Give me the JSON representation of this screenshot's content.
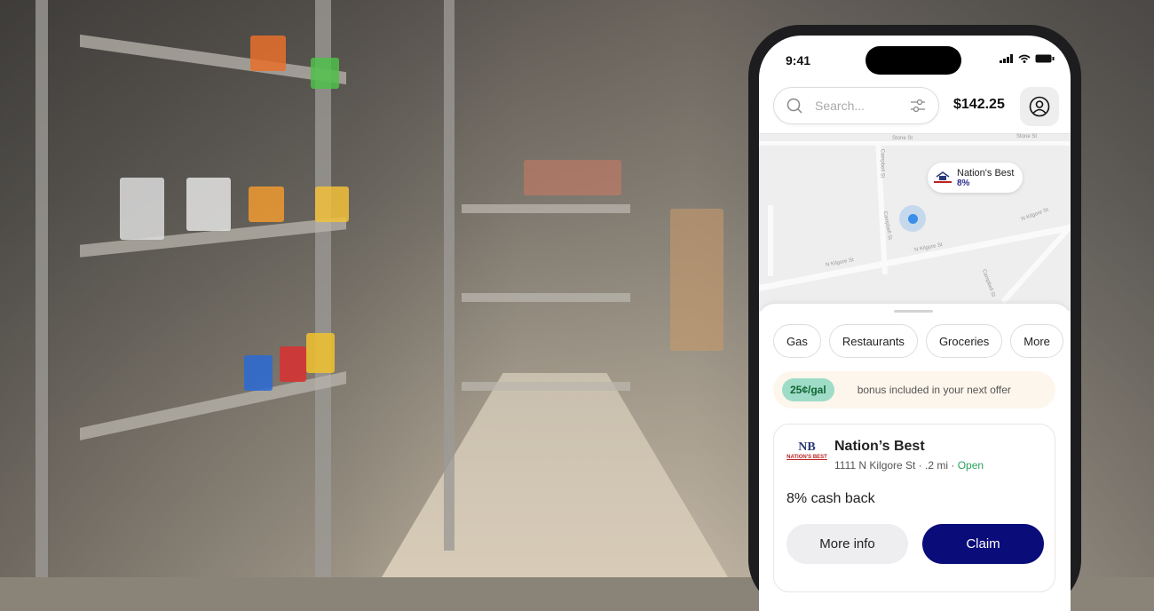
{
  "status_bar": {
    "time": "9:41"
  },
  "header": {
    "search_placeholder": "Search...",
    "balance": "$142.25"
  },
  "map": {
    "streets": [
      "Stone St",
      "Stone St",
      "Campbell St",
      "Campbell St",
      "N Kilgore St",
      "N Kilgore St",
      "N Kilgore St",
      "Campbell St"
    ],
    "pin": {
      "name": "Nation's Best",
      "percent": "8%"
    }
  },
  "categories": [
    "Gas",
    "Restaurants",
    "Groceries",
    "More"
  ],
  "banner": {
    "badge": "25¢/gal",
    "text": "bonus included in your next offer"
  },
  "offer": {
    "logo_text": "NB",
    "logo_caption": "NATION'S BEST",
    "name": "Nation’s Best",
    "address": "1111 N Kilgore St · .2 mi · ",
    "status": "Open",
    "cashback": "8% cash back",
    "more_info_label": "More info",
    "claim_label": "Claim"
  },
  "colors": {
    "accent": "#0a0c7a",
    "open": "#2aa35e",
    "badge": "#9fdcc8",
    "location": "#3a8eea"
  }
}
